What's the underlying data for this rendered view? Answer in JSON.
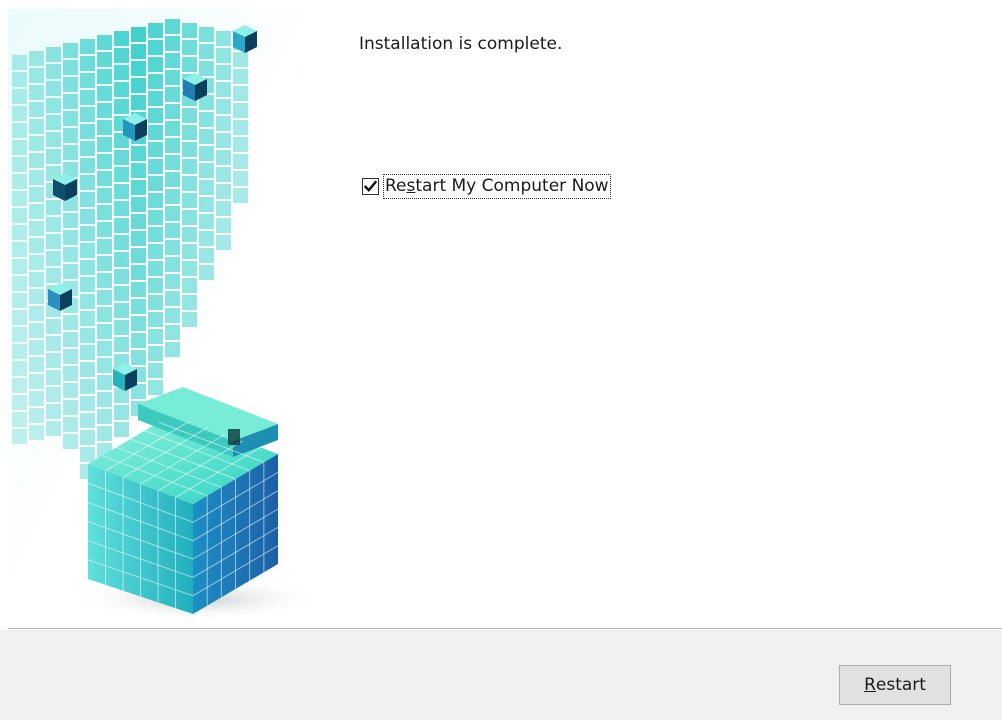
{
  "message": "Installation is complete.",
  "restart_option": {
    "label_before": "Re",
    "label_mnemonic": "s",
    "label_after": "tart My Computer Now",
    "checked": true
  },
  "footer": {
    "restart_button": {
      "mnemonic": "R",
      "label_rest": "estart"
    }
  },
  "colors": {
    "banner_teal": "#2bc7c4",
    "banner_blue": "#1f6fb3",
    "footer_bg": "#f0f0f0",
    "button_bg": "#e1e1e1"
  },
  "icons": {
    "checkbox": "checkmark-icon"
  }
}
